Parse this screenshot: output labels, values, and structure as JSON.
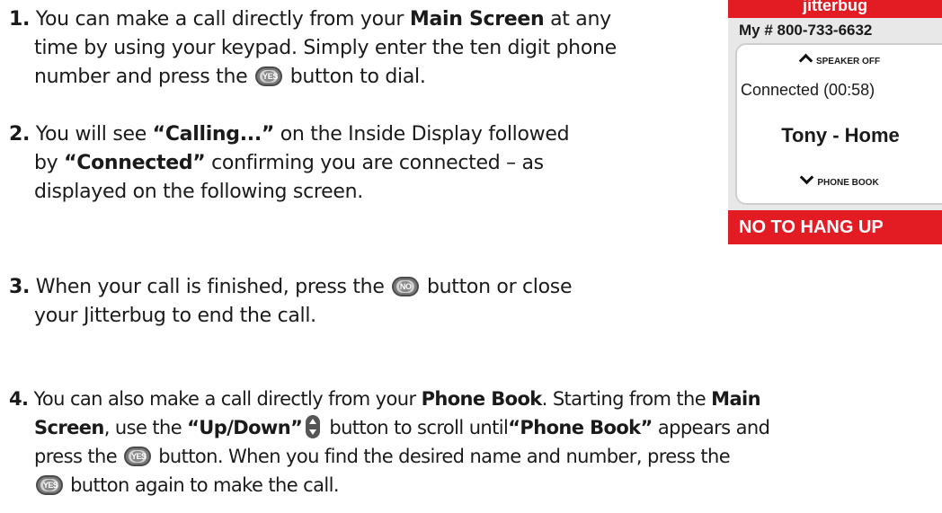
{
  "phone_display": {
    "brand": "jitterbug",
    "my_number": "My # 800-733-6632",
    "speaker": "SPEAKER OFF",
    "status": "Connected (00:58)",
    "contact": "Tony - Home",
    "phone_book": "PHONE BOOK",
    "hang_up": "NO TO HANG UP"
  },
  "keys": {
    "yes": "YES",
    "no": "NO"
  },
  "steps": [
    {
      "number": "1.",
      "l1a": "You can make a call directly from your ",
      "l1b": "Main Screen",
      "l1c": " at any",
      "l2": "time by using your keypad. Simply enter the ten digit phone",
      "l3a": "number and press the ",
      "l3b": " button to dial."
    },
    {
      "number": "2.",
      "l1a": "You will see ",
      "l1b": "“Calling...”",
      "l1c": " on the Inside Display followed",
      "l2a": "by ",
      "l2b": "“Connected”",
      "l2c": " confirming you are connected – as",
      "l3": "displayed on the following screen."
    },
    {
      "number": "3.",
      "l1a": "When your call is finished, press the ",
      "l1b": " button or close",
      "l2": "your Jitterbug to end the call."
    },
    {
      "number": "4.",
      "l1a": "You can also make a call directly from your ",
      "l1b": "Phone Book",
      "l1c": ". Starting from the ",
      "l1d": "Main",
      "l2a": "Screen",
      "l2b": ", use the ",
      "l2c": "“Up/Down”",
      "l2d": " button to scroll until",
      "l2e": "“Phone Book”",
      "l2f": " appears and",
      "l3a": "press the ",
      "l3b": " button. When you find the desired name and number, press the",
      "l4": " button again to make the call."
    }
  ]
}
